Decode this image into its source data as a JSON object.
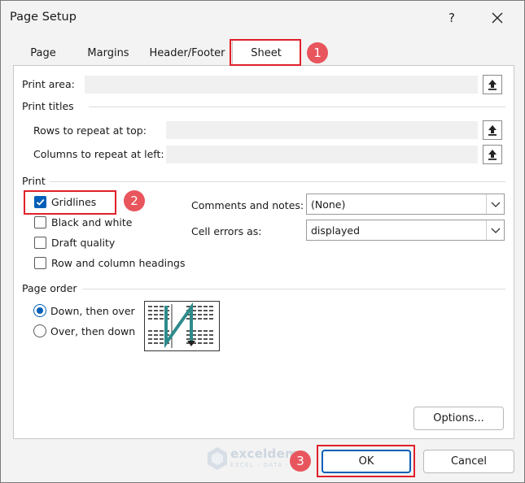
{
  "window": {
    "title": "Page Setup",
    "help_label": "?"
  },
  "tabs": [
    {
      "label": "Page"
    },
    {
      "label": "Margins"
    },
    {
      "label": "Header/Footer"
    },
    {
      "label": "Sheet",
      "selected": true
    }
  ],
  "print_area": {
    "label": "Print area:",
    "value": ""
  },
  "print_titles": {
    "heading": "Print titles",
    "rows_label": "Rows to repeat at top:",
    "rows_value": "",
    "cols_label": "Columns to repeat at left:",
    "cols_value": ""
  },
  "print": {
    "heading": "Print",
    "gridlines": {
      "label": "Gridlines",
      "checked": true
    },
    "black_white": {
      "label": "Black and white",
      "checked": false
    },
    "draft": {
      "label": "Draft quality",
      "checked": false
    },
    "headings": {
      "label": "Row and column headings",
      "checked": false
    },
    "comments_label": "Comments and notes:",
    "comments_value": "(None)",
    "errors_label": "Cell errors as:",
    "errors_value": "displayed"
  },
  "page_order": {
    "heading": "Page order",
    "down_then_over": {
      "label": "Down, then over",
      "selected": true
    },
    "over_then_down": {
      "label": "Over, then down",
      "selected": false
    }
  },
  "buttons": {
    "options": "Options...",
    "ok": "OK",
    "cancel": "Cancel"
  },
  "annotations": {
    "step1": "1",
    "step2": "2",
    "step3": "3",
    "highlight_color": "#e0202a",
    "badge_color": "#e8555d"
  },
  "watermark": {
    "name": "exceldemy",
    "tagline": "EXCEL · DATA · BI"
  },
  "colors": {
    "accent": "#005fb8",
    "dialog_bg": "#f3f3f3",
    "panel_bg": "#ffffff"
  }
}
